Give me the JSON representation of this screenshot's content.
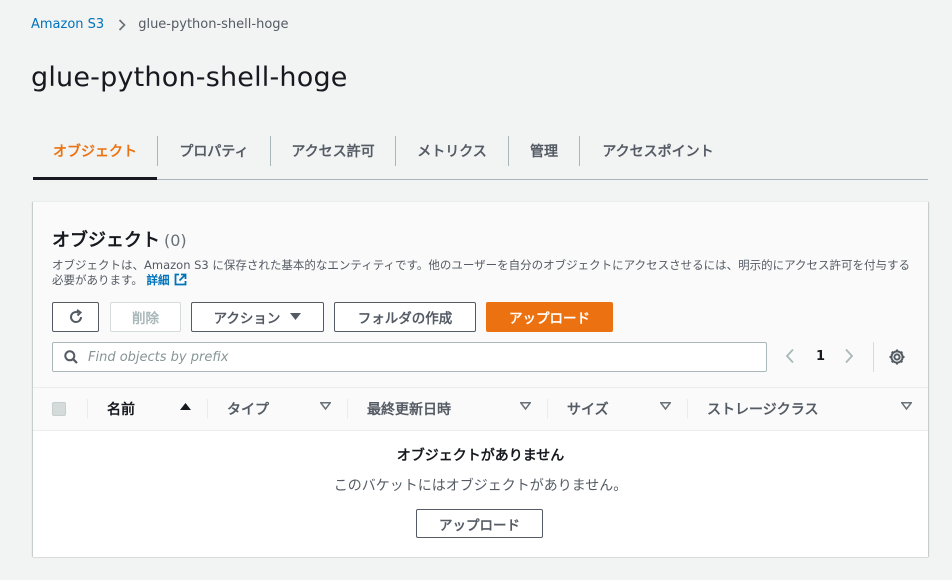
{
  "breadcrumb": {
    "root": "Amazon S3",
    "current": "glue-python-shell-hoge"
  },
  "page": {
    "title": "glue-python-shell-hoge"
  },
  "tabs": [
    {
      "label": "オブジェクト",
      "active": true
    },
    {
      "label": "プロパティ",
      "active": false
    },
    {
      "label": "アクセス許可",
      "active": false
    },
    {
      "label": "メトリクス",
      "active": false
    },
    {
      "label": "管理",
      "active": false
    },
    {
      "label": "アクセスポイント",
      "active": false
    }
  ],
  "objects_panel": {
    "title": "オブジェクト",
    "count": "(0)",
    "description": "オブジェクトは、Amazon S3 に保存された基本的なエンティティです。他のユーザーを自分のオブジェクトにアクセスさせるには、明示的にアクセス許可を付与する必要があります。",
    "more_link": "詳細",
    "buttons": {
      "refresh_icon": "refresh-icon",
      "delete": "削除",
      "actions": "アクション",
      "create_folder": "フォルダの作成",
      "upload": "アップロード"
    },
    "search": {
      "placeholder": "Find objects by prefix",
      "value": ""
    },
    "pagination": {
      "current_page": "1"
    },
    "table": {
      "columns": [
        "名前",
        "タイプ",
        "最終更新日時",
        "サイズ",
        "ストレージクラス"
      ],
      "sort_column": "名前",
      "sort_direction": "ascending"
    },
    "empty_state": {
      "title": "オブジェクトがありません",
      "description": "このバケットにはオブジェクトがありません。",
      "button": "アップロード"
    }
  },
  "colors": {
    "accent": "#ec7211",
    "link": "#0073bb",
    "text": "#16191f",
    "muted": "#545b64",
    "background": "#f2f3f3"
  }
}
